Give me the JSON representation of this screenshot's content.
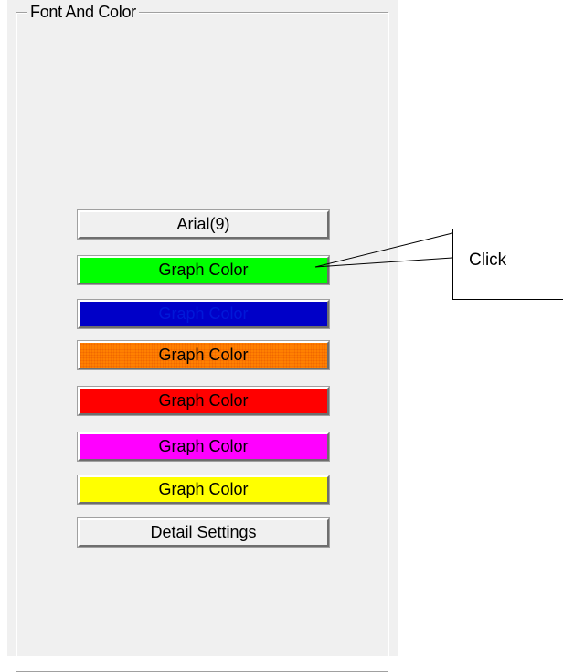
{
  "group": {
    "title": "Font And Color"
  },
  "buttons": {
    "font": "Arial(9)",
    "graph_color_green": "Graph Color",
    "graph_color_blue": "Graph Color",
    "graph_color_orange": "Graph Color",
    "graph_color_red": "Graph Color",
    "graph_color_magenta": "Graph Color",
    "graph_color_yellow": "Graph Color",
    "detail_settings": "Detail Settings"
  },
  "colors": {
    "green": "#00ff00",
    "blue": "#0000c8",
    "blue_text": "#0018d8",
    "orange": "#ff8000",
    "red": "#ff0000",
    "magenta": "#ff00ff",
    "yellow": "#ffff00"
  },
  "callout": {
    "text": "Click"
  }
}
